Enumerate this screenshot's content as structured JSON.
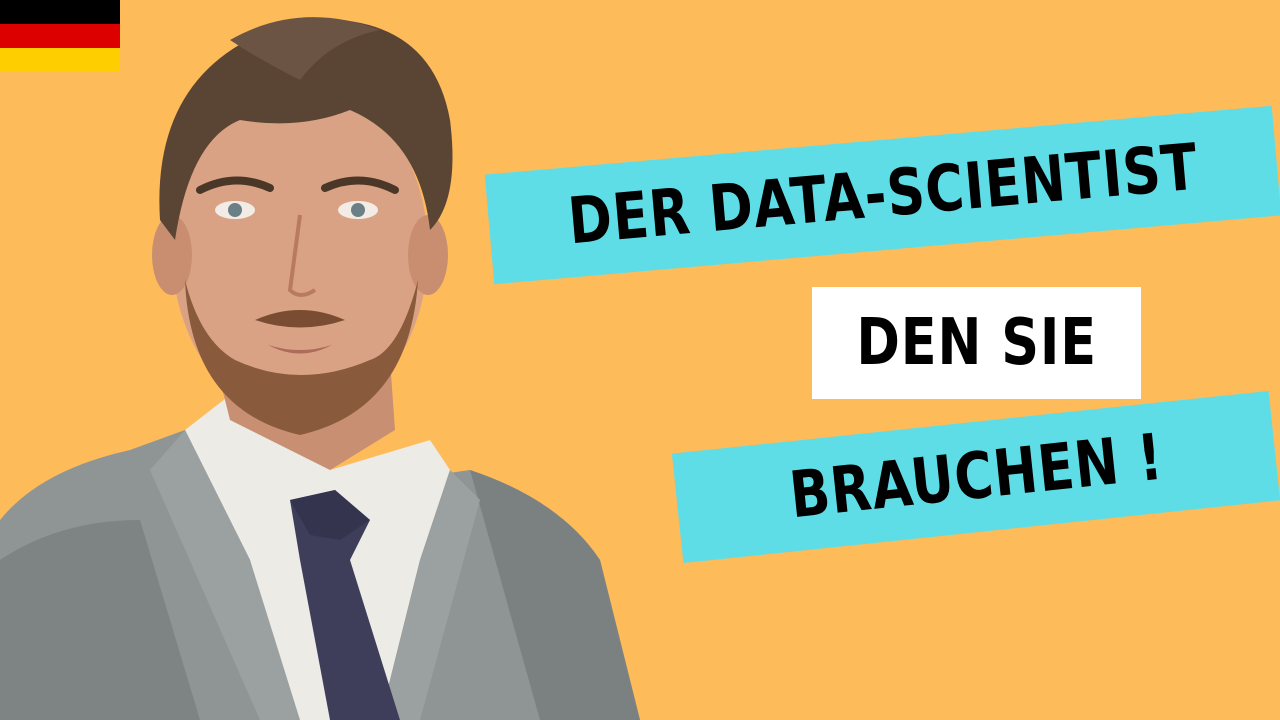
{
  "flag": {
    "icon": "germany-flag-icon",
    "stripes": [
      "#000000",
      "#dd0000",
      "#ffce00"
    ]
  },
  "colors": {
    "background": "#fdbb5a",
    "accent_banner": "#5fdde7",
    "white_banner": "#ffffff"
  },
  "headline": {
    "line1": "DER DATA-SCIENTIST",
    "line2": "DEN SIE",
    "line3": "BRAUCHEN !"
  }
}
